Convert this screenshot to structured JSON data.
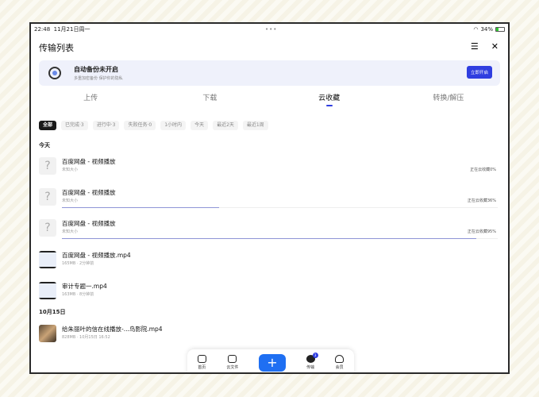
{
  "status": {
    "time": "22:48",
    "date": "11月21日周一",
    "battery": "34%"
  },
  "header": {
    "title": "传输列表",
    "menu_icon": "list-icon",
    "close_icon": "close-icon"
  },
  "banner": {
    "title": "自动备份未开启",
    "subtitle": "多重加密备份 保护你的隐私",
    "button": "立即开启"
  },
  "tabs": [
    {
      "label": "上传"
    },
    {
      "label": "下载"
    },
    {
      "label": "云收藏",
      "active": true
    },
    {
      "label": "转换/解压"
    }
  ],
  "chips": [
    "全部",
    "已完成·3",
    "进行中·3",
    "失败任务·0",
    "1小时内",
    "今天",
    "最近2天",
    "最近1周"
  ],
  "sections": {
    "today": "今天",
    "oct15": "10月15日"
  },
  "items": [
    {
      "name": "百度网盘 - 视频播放",
      "meta": "未知大小",
      "status": "正在云收藏0%",
      "progress": 0
    },
    {
      "name": "百度网盘 - 视频播放",
      "meta": "未知大小",
      "status": "正在云收藏36%",
      "progress": 36
    },
    {
      "name": "百度网盘 - 视频播放",
      "meta": "未知大小",
      "status": "正在云收藏95%",
      "progress": 95
    },
    {
      "name": "百度网盘 - 视频播放.mp4",
      "meta": "165MB · 2分钟前"
    },
    {
      "name": "审计专题一.mp4",
      "meta": "163MB · 8分钟前"
    },
    {
      "name": "给朱丽叶的信在线播放-...鸟影院.mp4",
      "meta": "828MB · 10月15日 16:52"
    }
  ],
  "nav": {
    "home": "首页",
    "files": "云文件",
    "transfer": "传输",
    "transfer_badge": "3",
    "vip": "会员"
  },
  "colors": {
    "accent": "#2f3ee0",
    "plus": "#1f6ff2"
  }
}
